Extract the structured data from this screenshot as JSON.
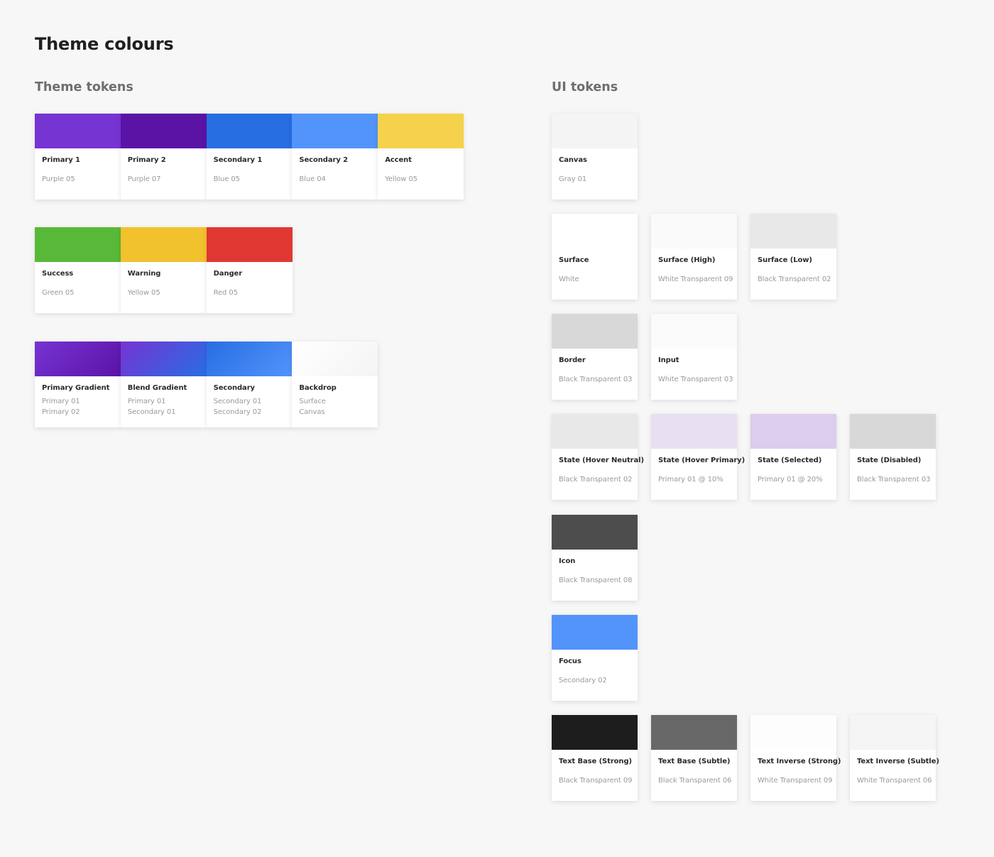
{
  "page": {
    "title": "Theme colours"
  },
  "theme_tokens": {
    "title": "Theme tokens",
    "rows": [
      [
        {
          "name": "Primary 1",
          "sub": [
            "Purple 05"
          ],
          "color": "#7634d3"
        },
        {
          "name": "Primary 2",
          "sub": [
            "Purple 07"
          ],
          "color": "#5b13a6"
        },
        {
          "name": "Secondary 1",
          "sub": [
            "Blue 05"
          ],
          "color": "#276ee3"
        },
        {
          "name": "Secondary 2",
          "sub": [
            "Blue 04"
          ],
          "color": "#5394fb"
        },
        {
          "name": "Accent",
          "sub": [
            "Yellow 05"
          ],
          "color": "#f6d24c"
        }
      ],
      [
        {
          "name": "Success",
          "sub": [
            "Green 05"
          ],
          "color": "#58b938"
        },
        {
          "name": "Warning",
          "sub": [
            "Yellow 05"
          ],
          "color": "#f2c12e"
        },
        {
          "name": "Danger",
          "sub": [
            "Red 05"
          ],
          "color": "#e13732"
        }
      ],
      [
        {
          "name": "Primary Gradient",
          "sub": [
            "Primary 01",
            "Primary 02"
          ],
          "gradient": [
            "#7634d3",
            "#5b13a6"
          ]
        },
        {
          "name": "Blend Gradient",
          "sub": [
            "Primary 01",
            "Secondary 01"
          ],
          "gradient": [
            "#7634d3",
            "#276ee3"
          ]
        },
        {
          "name": "Secondary",
          "sub": [
            "Secondary 01",
            "Secondary 02"
          ],
          "gradient": [
            "#276ee3",
            "#5394fb"
          ]
        },
        {
          "name": "Backdrop",
          "sub": [
            "Surface",
            "Canvas"
          ],
          "gradient": [
            "#ffffff",
            "#f4f4f4"
          ]
        }
      ]
    ]
  },
  "ui_tokens": {
    "title": "UI tokens",
    "rows": [
      [
        {
          "name": "Canvas",
          "sub": [
            "Gray 01"
          ],
          "color": "#f4f4f4"
        }
      ],
      [
        {
          "name": "Surface",
          "sub": [
            "White"
          ],
          "color": "#ffffff"
        },
        {
          "name": "Surface (High)",
          "sub": [
            "White Transparent 09"
          ],
          "color": "#fafafa"
        },
        {
          "name": "Surface (Low)",
          "sub": [
            "Black Transparent 02"
          ],
          "color": "#e8e8e8"
        }
      ],
      [
        {
          "name": "Border",
          "sub": [
            "Black Transparent 03"
          ],
          "color": "#d8d8d8"
        },
        {
          "name": "Input",
          "sub": [
            "White Transparent 03"
          ],
          "color": "#fbfbfb"
        }
      ],
      [
        {
          "name": "State (Hover Neutral)",
          "sub": [
            "Black Transparent 02"
          ],
          "color": "#e8e8e8"
        },
        {
          "name": "State (Hover Primary)",
          "sub": [
            "Primary 01 @ 10%"
          ],
          "color": "#e7e0f1"
        },
        {
          "name": "State (Selected)",
          "sub": [
            "Primary 01 @ 20%"
          ],
          "color": "#dccced"
        },
        {
          "name": "State (Disabled)",
          "sub": [
            "Black Transparent 03"
          ],
          "color": "#d8d8d8"
        }
      ],
      [
        {
          "name": "Icon",
          "sub": [
            "Black Transparent 08"
          ],
          "color": "#4d4d4d"
        }
      ],
      [
        {
          "name": "Focus",
          "sub": [
            "Secondary 02"
          ],
          "color": "#5394fb"
        }
      ],
      [
        {
          "name": "Text Base (Strong)",
          "sub": [
            "Black Transparent 09"
          ],
          "color": "#1d1d1d"
        },
        {
          "name": "Text Base (Subtle)",
          "sub": [
            "Black Transparent 06"
          ],
          "color": "#686868"
        },
        {
          "name": "Text Inverse (Strong)",
          "sub": [
            "White Transparent 09"
          ],
          "color": "#fdfdfd"
        },
        {
          "name": "Text Inverse (Subtle)",
          "sub": [
            "White Transparent 06"
          ],
          "color": "#f5f5f5"
        }
      ]
    ]
  }
}
